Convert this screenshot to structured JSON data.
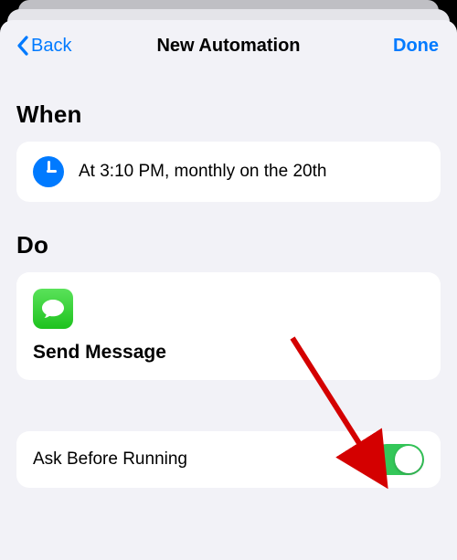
{
  "nav": {
    "back_label": "Back",
    "title": "New Automation",
    "done_label": "Done"
  },
  "sections": {
    "when_header": "When",
    "do_header": "Do"
  },
  "when": {
    "description": "At 3:10 PM, monthly on the 20th"
  },
  "do": {
    "action_title": "Send Message",
    "app_icon": "messages-app"
  },
  "settings": {
    "ask_label": "Ask Before Running",
    "ask_enabled": true
  },
  "colors": {
    "ios_blue": "#007aff",
    "ios_green": "#34c759",
    "sheet_bg": "#f2f2f7"
  }
}
